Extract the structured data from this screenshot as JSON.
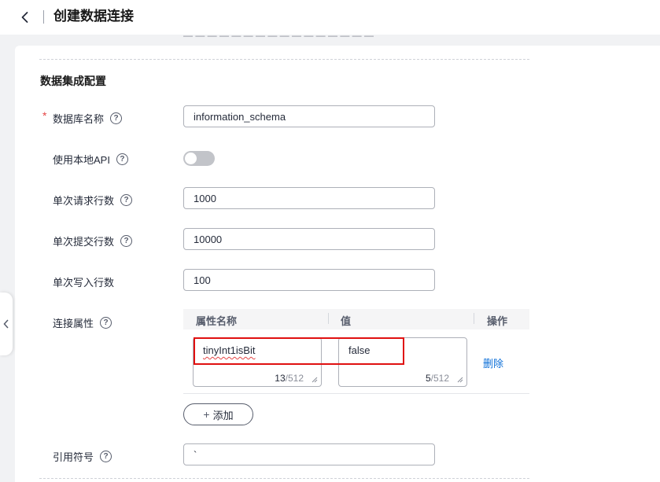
{
  "header": {
    "title": "创建数据连接"
  },
  "section": {
    "title": "数据集成配置"
  },
  "fields": {
    "db_name": {
      "label": "数据库名称",
      "required_mark": "*",
      "value": "information_schema"
    },
    "local_api": {
      "label": "使用本地API",
      "enabled": false
    },
    "fetch_rows": {
      "label": "单次请求行数",
      "value": "1000"
    },
    "commit_rows": {
      "label": "单次提交行数",
      "value": "10000"
    },
    "write_rows": {
      "label": "单次写入行数",
      "value": "100"
    },
    "conn_props": {
      "label": "连接属性"
    },
    "quote_char": {
      "label": "引用符号",
      "value": "`"
    }
  },
  "table": {
    "headers": [
      "属性名称",
      "值",
      "操作"
    ],
    "rows": [
      {
        "name": "tinyInt1isBit",
        "name_count": "13",
        "value": "false",
        "value_count": "5",
        "max": "/512",
        "action": "删除"
      }
    ]
  },
  "add_button": {
    "label": "添加",
    "icon": "plus-icon"
  },
  "help_icon_glyph": "?",
  "colors": {
    "accent_link": "#0c6fd8",
    "required": "#e54545",
    "highlight_box": "#e01010"
  }
}
